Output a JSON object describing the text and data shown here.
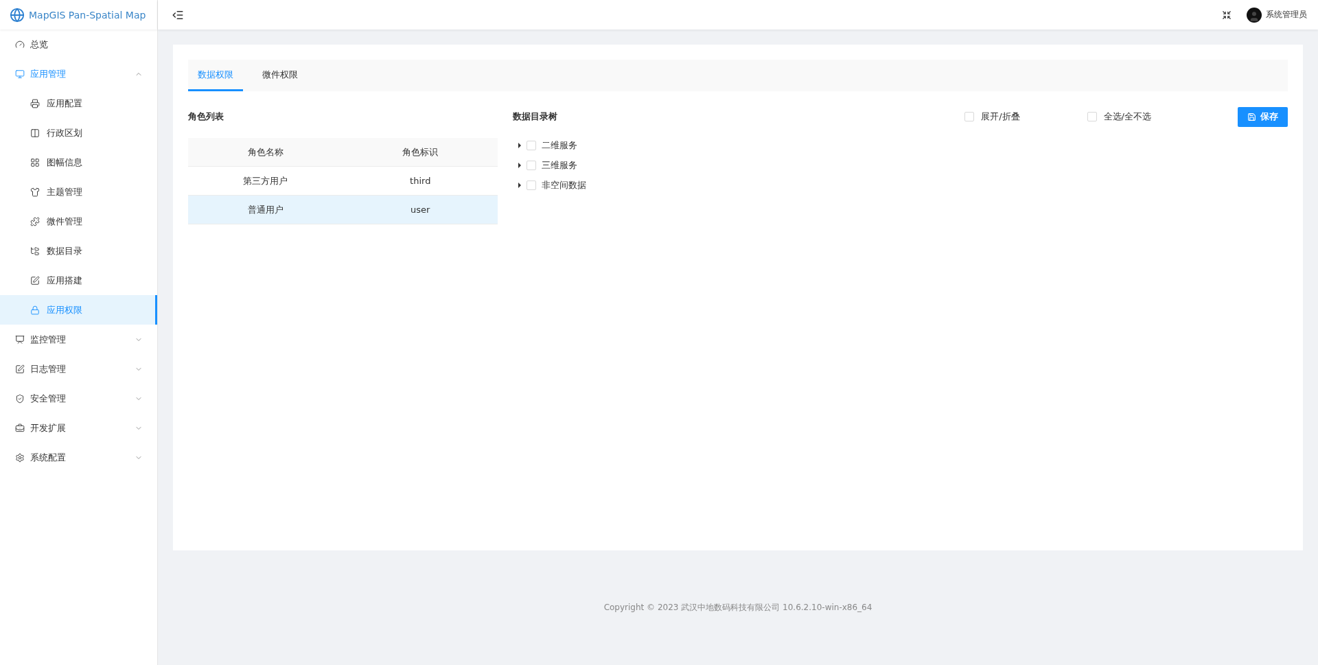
{
  "brand": {
    "title": "MapGIS Pan-Spatial Map"
  },
  "header": {
    "user": "系统管理员"
  },
  "sidebar": {
    "items": [
      {
        "kind": "link",
        "label": "总览",
        "selected": false
      },
      {
        "kind": "group",
        "label": "应用管理",
        "selected": true,
        "expanded": true,
        "children": [
          {
            "label": "应用配置",
            "selected": false
          },
          {
            "label": "行政区划",
            "selected": false
          },
          {
            "label": "图幅信息",
            "selected": false
          },
          {
            "label": "主题管理",
            "selected": false
          },
          {
            "label": "微件管理",
            "selected": false
          },
          {
            "label": "数据目录",
            "selected": false
          },
          {
            "label": "应用搭建",
            "selected": false
          },
          {
            "label": "应用权限",
            "selected": true
          }
        ]
      },
      {
        "kind": "group",
        "label": "监控管理",
        "selected": false,
        "expanded": false
      },
      {
        "kind": "group",
        "label": "日志管理",
        "selected": false,
        "expanded": false
      },
      {
        "kind": "group",
        "label": "安全管理",
        "selected": false,
        "expanded": false
      },
      {
        "kind": "group",
        "label": "开发扩展",
        "selected": false,
        "expanded": false
      },
      {
        "kind": "group",
        "label": "系统配置",
        "selected": false,
        "expanded": false
      }
    ]
  },
  "tabs": [
    {
      "label": "数据权限",
      "selected": true
    },
    {
      "label": "微件权限",
      "selected": false
    }
  ],
  "roles": {
    "title": "角色列表",
    "columns": [
      "角色名称",
      "角色标识"
    ],
    "rows": [
      {
        "cells": [
          "第三方用户",
          "third"
        ],
        "selected": false
      },
      {
        "cells": [
          "普通用户",
          "user"
        ],
        "selected": true
      }
    ]
  },
  "tree": {
    "title": "数据目录树",
    "expand_all": {
      "label": "展开/折叠",
      "checked": false
    },
    "select_all": {
      "label": "全选/全不选",
      "checked": false
    },
    "save_button": "保存",
    "nodes": [
      {
        "label": "二维服务",
        "checked": false,
        "expanded": false
      },
      {
        "label": "三维服务",
        "checked": false,
        "expanded": false
      },
      {
        "label": "非空间数据",
        "checked": false,
        "expanded": false
      }
    ]
  },
  "footer": "Copyright © 2023 武汉中地数码科技有限公司 10.6.2.10-win-x86_64"
}
